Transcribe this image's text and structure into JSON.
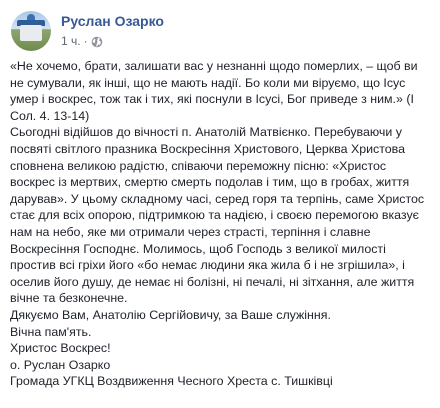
{
  "post": {
    "author": "Руслан Озарко",
    "time": "1 ч.",
    "separator": "·",
    "privacy_icon": "globe-icon",
    "paragraphs": [
      "«Не хочемо, брати, залишати вас у незнанні щодо померлих, – щоб ви не сумували, як інші, що не мають надії. Бо коли ми віруємо, що Ісус умер і воскрес, тож так і тих, які поснули в Ісусі, Бог приведе з ним.» (І Сол. 4. 13-14)",
      "Сьогодні відійшов до вічності п. Анатолій Матвієнко. Перебуваючи у посвяті світлого празника Воскресіння Христового, Церква Христова сповнена великою радістю, співаючи переможну пісню: «Христос воскрес із мертвих, смертю смерть подолав і тим, що в гробах, життя дарував». У цьому складному часі, серед горя та терпінь, саме Христос стає для всіх опорою, підтримкою та надією, і своєю перемогою вказує нам на небо, яке ми отримали через страсті, терпіння і славне Воскресіння Господнє. Молимось, щоб Господь з великої милості простив всі гріхи його «бо немає людини яка жила б і не згрішила», і оселив його душу, де немає ні болізні, ні печалі, ні зітхання, але життя вічне та безконечне.",
      "Дякуємо Вам, Анатолію Сергійовичу, за Ваше служіння.",
      "Вічна пам'ять.",
      "Христос Воскрес!",
      "о. Руслан Озарко",
      "Громада УГКЦ Воздвиження Чесного Хреста с. Тишківці"
    ]
  }
}
